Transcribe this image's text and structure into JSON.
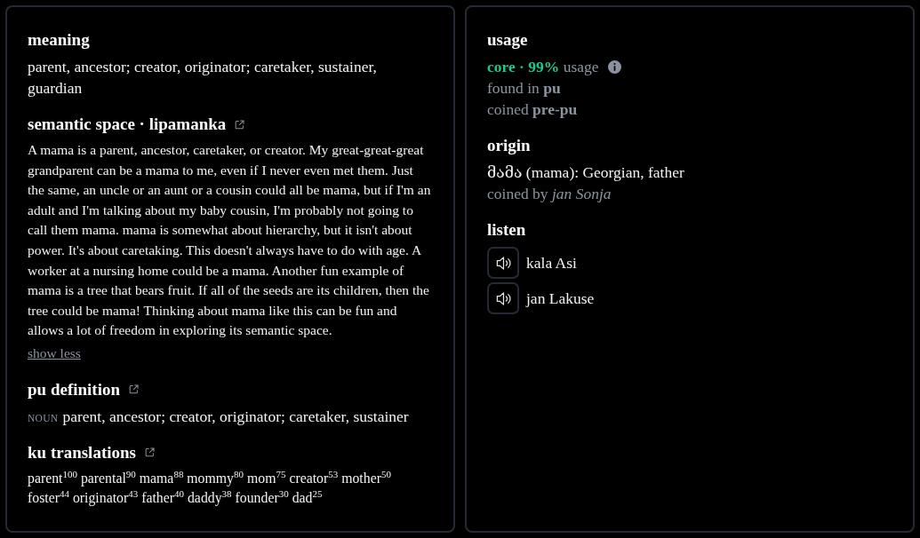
{
  "left_panel": {
    "sections": [
      {
        "kind": "text",
        "heading": "meaning",
        "external_link": false,
        "text": "parent, ancestor; creator, originator; caretaker, sustainer, guardian"
      },
      {
        "kind": "essay",
        "heading": "semantic space · lipamanka",
        "external_link": true,
        "text": "A mama is a parent, ancestor, caretaker, or creator. My great-great-great grandparent can be a mama to me, even if I never even met them. Just the same, an uncle or an aunt or a cousin could all be mama, but if I'm an adult and I'm talking about my baby cousin, I'm probably not going to call them mama. mama is somewhat about hierarchy, but it isn't about power. It's about caretaking. This doesn't always have to do with age. A worker at a nursing home could be a mama. Another fun example of mama is a tree that bears fruit. If all of the seeds are its children, then the tree could be mama! Thinking about mama like this can be fun and allows a lot of freedom in exploring its semantic space.",
        "toggle": "show less"
      },
      {
        "kind": "definition",
        "heading": "pu definition",
        "external_link": true,
        "part_of_speech": "NOUN",
        "text": "parent, ancestor; creator, originator; caretaker, sustainer"
      },
      {
        "kind": "translations",
        "heading": "ku translations",
        "external_link": true,
        "items": [
          {
            "word": "parent",
            "score": "100"
          },
          {
            "word": "parental",
            "score": "90"
          },
          {
            "word": "mama",
            "score": "88"
          },
          {
            "word": "mommy",
            "score": "80"
          },
          {
            "word": "mom",
            "score": "75"
          },
          {
            "word": "creator",
            "score": "53"
          },
          {
            "word": "mother",
            "score": "50"
          },
          {
            "word": "foster",
            "score": "44"
          },
          {
            "word": "originator",
            "score": "43"
          },
          {
            "word": "father",
            "score": "40"
          },
          {
            "word": "daddy",
            "score": "38"
          },
          {
            "word": "founder",
            "score": "30"
          },
          {
            "word": "dad",
            "score": "25"
          }
        ]
      }
    ]
  },
  "right_panel": {
    "sections": [
      {
        "kind": "usage",
        "heading": "usage",
        "category": "core · 99%",
        "category_label": "usage",
        "found_in": "found in **pu**",
        "coined": "coined **pre-pu**"
      },
      {
        "kind": "origin",
        "heading": "origin",
        "text": "მამა (mama): Georgian, father",
        "credit": "coined by *jan Sonja*"
      },
      {
        "kind": "audio",
        "heading": "listen",
        "recordings": [
          {
            "speaker": "kala Asi"
          },
          {
            "speaker": "jan Lakuse"
          }
        ]
      }
    ]
  }
}
